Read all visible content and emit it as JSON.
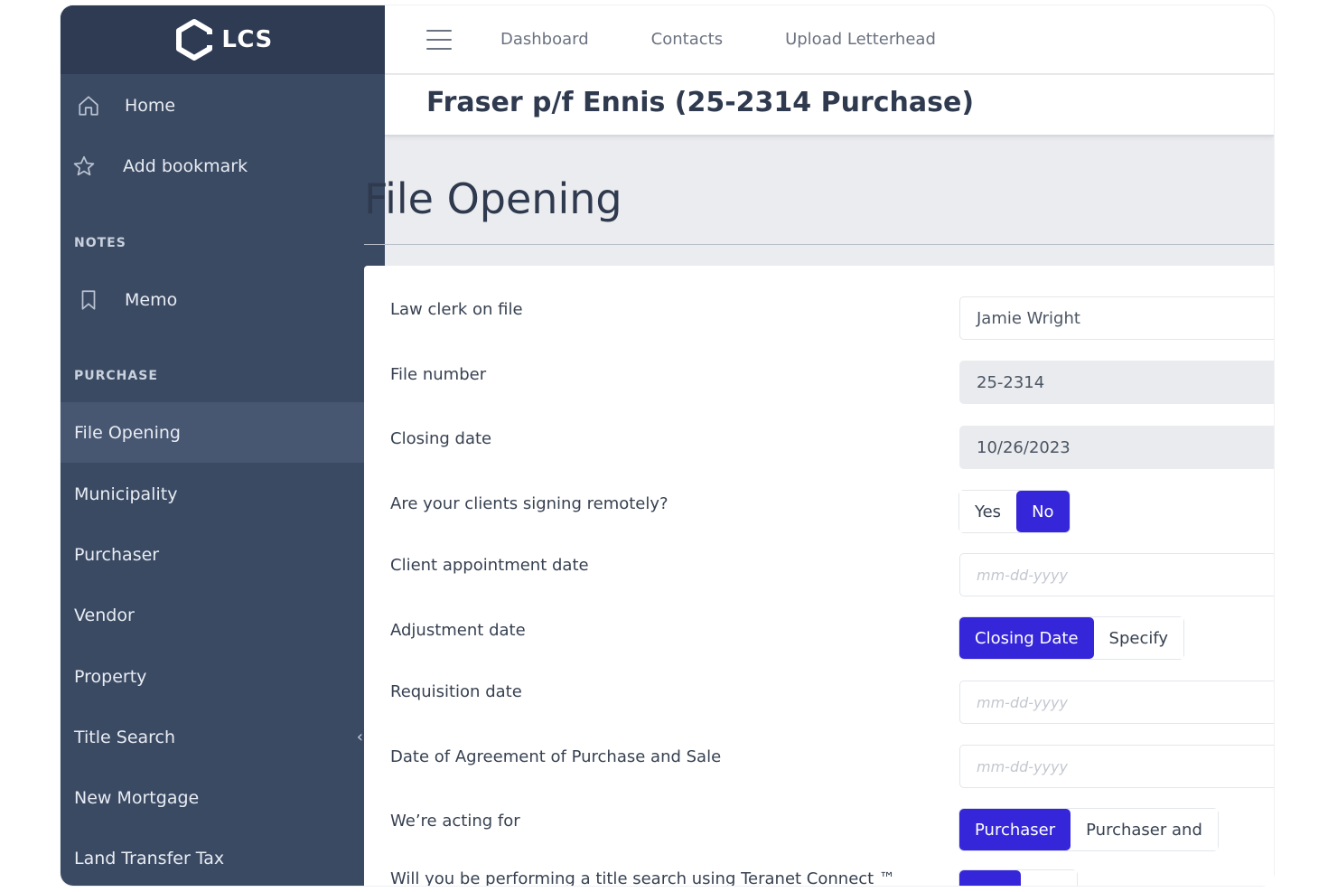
{
  "app": {
    "brand_name": "LCS",
    "accent_color": "#3526d9",
    "sidebar_color": "#3b4a63"
  },
  "sidebar": {
    "home_label": "Home",
    "bookmark_label": "Add bookmark",
    "notes_heading": "NOTES",
    "memo_label": "Memo",
    "purchase_heading": "PURCHASE",
    "items": [
      {
        "label": "File Opening",
        "active": true
      },
      {
        "label": "Municipality"
      },
      {
        "label": "Purchaser"
      },
      {
        "label": "Vendor"
      },
      {
        "label": "Property"
      },
      {
        "label": "Title Search",
        "chevron": "‹"
      },
      {
        "label": "New Mortgage"
      },
      {
        "label": "Land Transfer Tax"
      }
    ]
  },
  "topbar": {
    "links": [
      "Dashboard",
      "Contacts",
      "Upload Letterhead"
    ]
  },
  "file_title": "Fraser p/f Ennis (25-2314 Purchase)",
  "page": {
    "title": "File Opening"
  },
  "form": {
    "law_clerk": {
      "label": "Law clerk on file",
      "value": "Jamie Wright"
    },
    "file_number": {
      "label": "File number",
      "value": "25-2314"
    },
    "closing_date": {
      "label": "Closing date",
      "value": "10/26/2023"
    },
    "remote_signing": {
      "label": "Are your clients signing remotely?",
      "options": [
        "Yes",
        "No"
      ],
      "selected": "No"
    },
    "client_appointment": {
      "label": "Client appointment date",
      "placeholder": "mm-dd-yyyy"
    },
    "adjustment_date": {
      "label": "Adjustment date",
      "options": [
        "Closing Date",
        "Specify"
      ],
      "selected": "Closing Date"
    },
    "requisition_date": {
      "label": "Requisition date",
      "placeholder": "mm-dd-yyyy"
    },
    "agreement_date": {
      "label": "Date of Agreement of Purchase and Sale",
      "placeholder": "mm-dd-yyyy"
    },
    "acting_for": {
      "label": "We’re acting for",
      "options": [
        "Purchaser",
        "Purchaser and"
      ],
      "selected": "Purchaser"
    },
    "title_search_question": {
      "label": "Will you be performing a title search using Teranet Connect ™"
    }
  }
}
